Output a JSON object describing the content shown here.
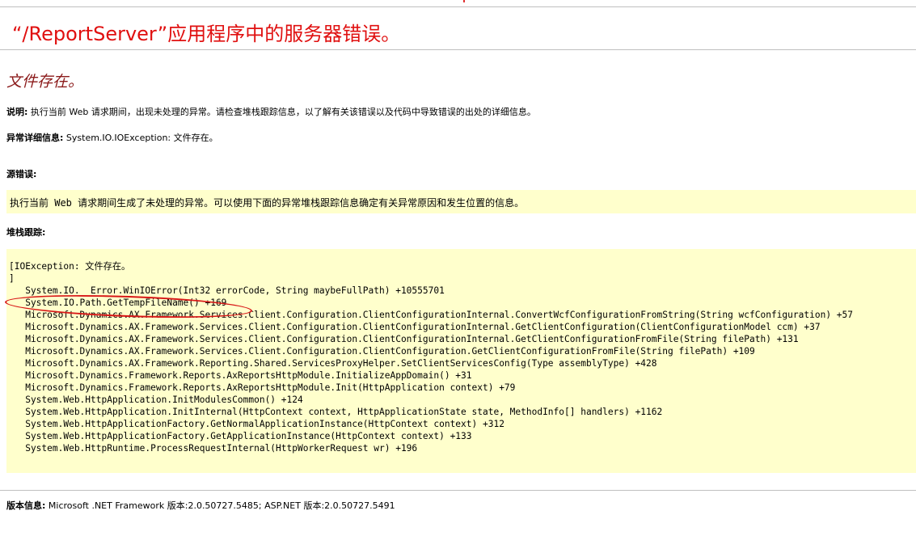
{
  "header": {
    "title": "“/ReportServer”应用程序中的服务器错误。",
    "subtitle": "文件存在。"
  },
  "description": {
    "label": "说明:",
    "text": "执行当前 Web 请求期间，出现未处理的异常。请检查堆栈跟踪信息，以了解有关该错误以及代码中导致错误的出处的详细信息。"
  },
  "exception_details": {
    "label": "异常详细信息:",
    "text": "System.IO.IOException: 文件存在。"
  },
  "source_error": {
    "label": "源错误:",
    "text": "执行当前 Web 请求期间生成了未处理的异常。可以使用下面的异常堆栈跟踪信息确定有关异常原因和发生位置的信息。"
  },
  "stack_trace": {
    "label": "堆栈跟踪:",
    "text": "[IOException: 文件存在。\n]\n   System.IO.__Error.WinIOError(Int32 errorCode, String maybeFullPath) +10555701\n   System.IO.Path.GetTempFileName() +169\n   Microsoft.Dynamics.AX.Framework.Services.Client.Configuration.ClientConfigurationInternal.ConvertWcfConfigurationFromString(String wcfConfiguration) +57\n   Microsoft.Dynamics.AX.Framework.Services.Client.Configuration.ClientConfigurationInternal.GetClientConfiguration(ClientConfigurationModel ccm) +37\n   Microsoft.Dynamics.AX.Framework.Services.Client.Configuration.ClientConfigurationInternal.GetClientConfigurationFromFile(String filePath) +131\n   Microsoft.Dynamics.AX.Framework.Services.Client.Configuration.ClientConfiguration.GetClientConfigurationFromFile(String filePath) +109\n   Microsoft.Dynamics.AX.Framework.Reporting.Shared.ServicesProxyHelper.SetClientServicesConfig(Type assemblyType) +428\n   Microsoft.Dynamics.Framework.Reports.AxReportsHttpModule.InitializeAppDomain() +31\n   Microsoft.Dynamics.Framework.Reports.AxReportsHttpModule.Init(HttpApplication context) +79\n   System.Web.HttpApplication.InitModulesCommon() +124\n   System.Web.HttpApplication.InitInternal(HttpContext context, HttpApplicationState state, MethodInfo[] handlers) +1162\n   System.Web.HttpApplicationFactory.GetNormalApplicationInstance(HttpContext context) +312\n   System.Web.HttpApplicationFactory.GetApplicationInstance(HttpContext context) +133\n   System.Web.HttpRuntime.ProcessRequestInternal(HttpWorkerRequest wr) +196"
  },
  "version_info": {
    "label": "版本信息:",
    "text": "Microsoft .NET Framework 版本:2.0.50727.5485; ASP.NET 版本:2.0.50727.5491"
  },
  "colors": {
    "title": "#e01010",
    "subtitle": "#8b1a1a",
    "code_box_bg": "#ffffcc",
    "annotation_circle": "#d81818"
  }
}
